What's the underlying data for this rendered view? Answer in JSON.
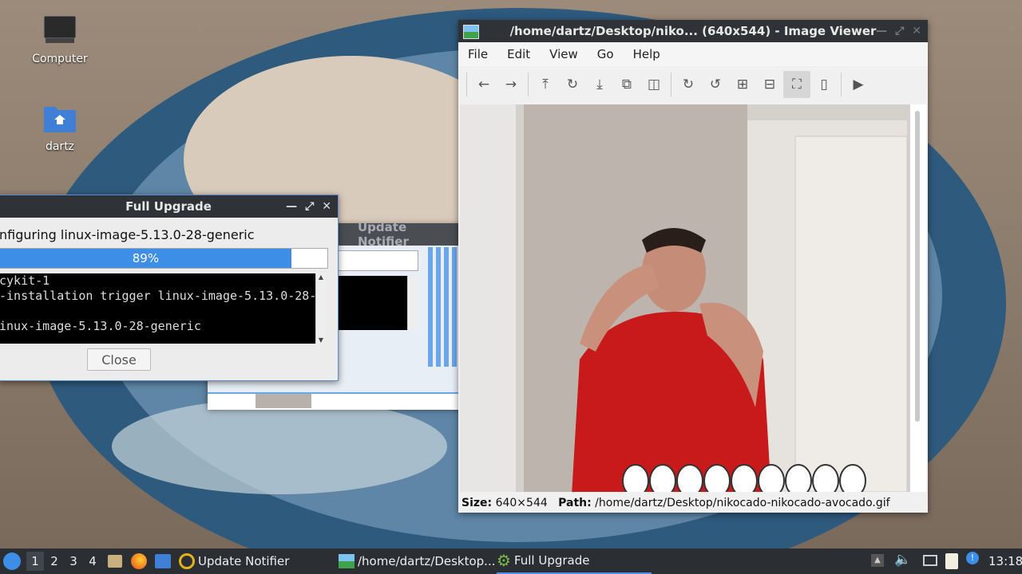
{
  "desktop": {
    "icons": [
      {
        "label": "Computer",
        "icon": "computer-icon"
      },
      {
        "label": "dartz",
        "icon": "home-folder-icon"
      }
    ]
  },
  "upgrade_window": {
    "title": "Full Upgrade",
    "status": "nfiguring linux-image-5.13.0-28-generic",
    "progress_percent": 89,
    "progress_label": "89%",
    "terminal_lines": [
      "cykit-1",
      "-installation trigger linux-image-5.13.0-28-",
      "",
      "inux-image-5.13.0-28-generic"
    ],
    "close_label": "Close"
  },
  "notifier_window": {
    "title": "Update Notifier"
  },
  "viewer_window": {
    "title": "/home/dartz/Desktop/niko...  (640x544) - Image Viewer",
    "menu": [
      "File",
      "Edit",
      "View",
      "Go",
      "Help"
    ],
    "status": {
      "size_label": "Size:",
      "size_value": "640×544",
      "path_label": "Path:",
      "path_value": "/home/dartz/Desktop/nikocado-nikocado-avocado.gif"
    }
  },
  "taskbar": {
    "workspaces": [
      "1",
      "2",
      "3",
      "4"
    ],
    "active_workspace": "1",
    "tasks": [
      {
        "label": "Update Notifier",
        "icon": "update-notifier-icon"
      },
      {
        "label": "/home/dartz/Desktop...",
        "icon": "image-viewer-icon"
      },
      {
        "label": "Full Upgrade",
        "icon": "gear-icon"
      }
    ],
    "clock": "13:18"
  },
  "colors": {
    "accent": "#3d8ee6",
    "titlebar": "#2f3236",
    "taskbar": "#2b2e33"
  }
}
